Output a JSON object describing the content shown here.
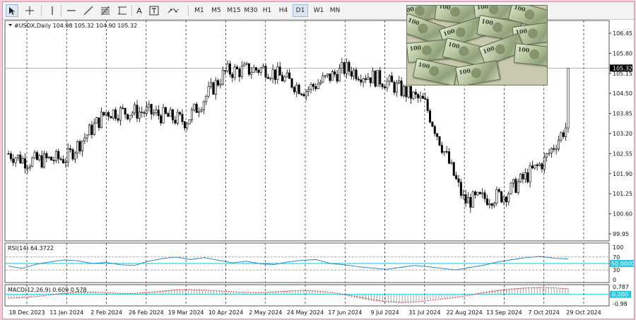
{
  "toolbar": {
    "periods": [
      "M1",
      "M5",
      "M15",
      "M30",
      "H1",
      "H4",
      "D1",
      "W1",
      "MN"
    ],
    "selected_period": "D1",
    "text_tool_label": "A"
  },
  "main_header": {
    "symbol": "#USDX,Daily",
    "ohlc": "104.98 105.32 104.90 105.32"
  },
  "current_price": "105.32",
  "rsi_header": {
    "title": "RSI(14)",
    "value": "64.3722"
  },
  "rsi_level_marker": "50.0000",
  "macd_header": {
    "title": "MACD(12,26,9)",
    "values": "0.609 0.578"
  },
  "macd_zero_marker": "0.000",
  "colors": {
    "bull_candle": "#ffffff",
    "bear_candle": "#000000",
    "rsi_line": "#1f77c9",
    "rsi_level_line": "#00c8e8",
    "macd_hist": "#9a9a9a",
    "macd_signal": "#d01010",
    "price_label_bg": "#000000",
    "level_marker_bg": "#2bc6e6"
  },
  "photo": {
    "denominations": [
      "100",
      "100",
      "100",
      "100",
      "100",
      "100",
      "100",
      "100",
      "100",
      "100",
      "100",
      "100",
      "100",
      "100"
    ]
  },
  "chart_data": [
    {
      "type": "candlestick",
      "title": "#USDX,Daily",
      "x_tick_labels": [
        "18 Dec 2023",
        "11 Jan 2024",
        "2 Feb 2024",
        "26 Feb 2024",
        "19 Mar 2024",
        "10 Apr 2024",
        "2 May 2024",
        "24 May 2024",
        "17 Jun 2024",
        "9 Jul 2024",
        "31 Jul 2024",
        "22 Aug 2024",
        "13 Sep 2024",
        "7 Oct 2024",
        "29 Oct 2024"
      ],
      "y_tick_labels": [
        "106.45",
        "105.80",
        "105.15",
        "104.50",
        "103.85",
        "103.20",
        "102.55",
        "101.90",
        "101.25",
        "100.60",
        "99.95"
      ],
      "ylim": [
        99.95,
        106.45
      ],
      "grid": "vertical dashed at date ticks",
      "last_price": 105.32,
      "series": [
        {
          "name": "#USDX,Daily",
          "close_path": [
            {
              "x": "18 Dec 2023",
              "y": 102.3
            },
            {
              "x": "11 Jan 2024",
              "y": 102.4
            },
            {
              "x": "2 Feb 2024",
              "y": 103.9
            },
            {
              "x": "26 Feb 2024",
              "y": 103.9
            },
            {
              "x": "19 Mar 2024",
              "y": 103.6
            },
            {
              "x": "10 Apr 2024",
              "y": 105.2
            },
            {
              "x": "2 May 2024",
              "y": 105.3
            },
            {
              "x": "24 May 2024",
              "y": 104.6
            },
            {
              "x": "17 Jun 2024",
              "y": 105.3
            },
            {
              "x": "9 Jul 2024",
              "y": 104.9
            },
            {
              "x": "31 Jul 2024",
              "y": 104.2
            },
            {
              "x": "22 Aug 2024",
              "y": 101.0
            },
            {
              "x": "13 Sep 2024",
              "y": 101.2
            },
            {
              "x": "7 Oct 2024",
              "y": 102.3
            },
            {
              "x": "29 Oct 2024",
              "y": 104.3
            },
            {
              "x": "end",
              "y": 105.32
            }
          ]
        }
      ]
    },
    {
      "type": "line",
      "title": "RSI(14)",
      "y_tick_labels": [
        "100",
        "70",
        "50",
        "30",
        "0"
      ],
      "ylim": [
        0,
        100
      ],
      "levels": [
        70,
        50,
        30
      ],
      "last_value": 64.3722,
      "series": [
        {
          "name": "RSI(14)",
          "values": [
            42,
            35,
            48,
            55,
            61,
            58,
            50,
            53,
            46,
            44,
            57,
            65,
            70,
            62,
            68,
            60,
            52,
            57,
            49,
            47,
            55,
            60,
            62,
            50,
            46,
            40,
            36,
            32,
            38,
            44,
            40,
            35,
            30,
            38,
            45,
            55,
            62,
            68,
            72,
            66,
            64
          ]
        }
      ]
    },
    {
      "type": "bar",
      "title": "MACD(12,26,9)",
      "y_tick_labels": [
        "0.787",
        "0.000",
        "-0.98"
      ],
      "ylim": [
        -0.98,
        0.787
      ],
      "last_values": [
        0.609,
        0.578
      ],
      "series": [
        {
          "name": "MACD(12,26,9)",
          "values": [
            -0.35,
            -0.3,
            -0.15,
            0.05,
            0.2,
            0.3,
            0.22,
            0.1,
            0.05,
            0.12,
            0.25,
            0.42,
            0.55,
            0.5,
            0.4,
            0.3,
            0.22,
            0.15,
            0.18,
            0.3,
            0.4,
            0.45,
            0.3,
            0.1,
            -0.15,
            -0.45,
            -0.7,
            -0.85,
            -0.9,
            -0.75,
            -0.55,
            -0.4,
            -0.25,
            0.05,
            0.3,
            0.5,
            0.62,
            0.72,
            0.75,
            0.65,
            0.61
          ]
        },
        {
          "name": "Signal",
          "values": [
            -0.4,
            -0.34,
            -0.22,
            -0.05,
            0.1,
            0.22,
            0.24,
            0.17,
            0.1,
            0.1,
            0.18,
            0.32,
            0.46,
            0.5,
            0.45,
            0.36,
            0.27,
            0.2,
            0.18,
            0.25,
            0.34,
            0.41,
            0.35,
            0.2,
            0.0,
            -0.28,
            -0.55,
            -0.75,
            -0.85,
            -0.8,
            -0.64,
            -0.48,
            -0.32,
            -0.08,
            0.18,
            0.4,
            0.55,
            0.66,
            0.72,
            0.68,
            0.58
          ]
        }
      ]
    }
  ]
}
